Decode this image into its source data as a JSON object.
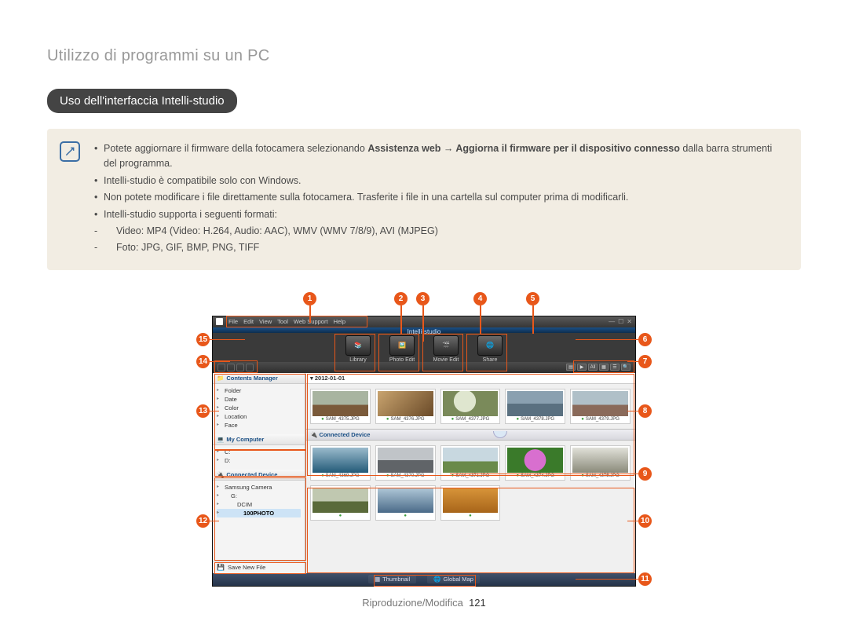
{
  "breadcrumb": "Utilizzo di programmi su un PC",
  "section_title": "Uso dell'interfaccia Intelli-studio",
  "note": {
    "items": [
      {
        "text_pre": "Potete aggiornare il firmware della fotocamera selezionando ",
        "bold": "Assistenza web → Aggiorna il firmware per il dispositivo connesso",
        "text_post": " dalla barra strumenti del programma."
      },
      {
        "text": "Intelli-studio è compatibile solo con Windows."
      },
      {
        "text": "Non potete modificare i file direttamente sulla fotocamera. Trasferite i file in una cartella sul computer prima di modificarli."
      },
      {
        "text": "Intelli-studio supporta i seguenti formati:",
        "subs": [
          "Video: MP4 (Video: H.264, Audio: AAC), WMV (WMV 7/8/9), AVI (MJPEG)",
          "Foto: JPG, GIF, BMP, PNG, TIFF"
        ]
      }
    ]
  },
  "app": {
    "menus": [
      "File",
      "Edit",
      "View",
      "Tool",
      "Web Support",
      "Help"
    ],
    "brand": "Intelli-studio",
    "quick": [
      {
        "label": "Library"
      },
      {
        "label": "Photo Edit"
      },
      {
        "label": "Movie Edit"
      },
      {
        "label": "Share"
      }
    ],
    "view_all": "All",
    "sidebar": {
      "contents_hdr": "Contents Manager",
      "contents": [
        "Folder",
        "Date",
        "Color",
        "Location",
        "Face"
      ],
      "mycomp_hdr": "My Computer",
      "mycomp": [
        "C:",
        "D:"
      ],
      "conn_hdr": "Connected Device",
      "conn": [
        "Samsung Camera",
        "G:",
        "DCIM",
        "100PHOTO"
      ],
      "save": "Save New File"
    },
    "date": "2012-01-01",
    "thumbs_top": [
      "SAM_4375.JPG",
      "SAM_4376.JPG",
      "SAM_4377.JPG",
      "SAM_4378.JPG",
      "SAM_4379.JPG"
    ],
    "thumbs_bot": [
      "SAM_4369.JPG",
      "SAM_4370.JPG",
      "SAM_4371.JPG",
      "SAM_4374.JPG",
      "SAM_4375.JPG"
    ],
    "footer": {
      "thumb": "Thumbnail",
      "map": "Global Map"
    }
  },
  "callouts": {
    "1": "1",
    "2": "2",
    "3": "3",
    "4": "4",
    "5": "5",
    "6": "6",
    "7": "7",
    "8": "8",
    "9": "9",
    "10": "10",
    "11": "11",
    "12": "12",
    "13": "13",
    "14": "14",
    "15": "15"
  },
  "page_footer": {
    "section": "Riproduzione/Modifica",
    "num": "121"
  }
}
